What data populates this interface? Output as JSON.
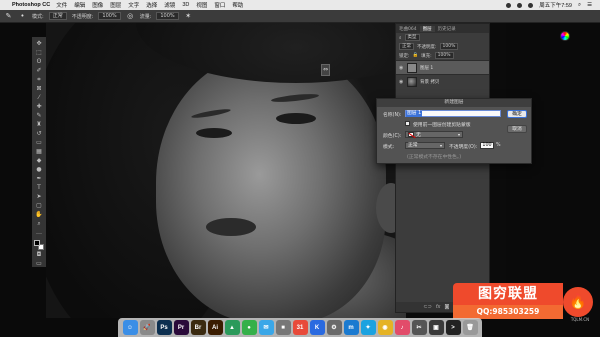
{
  "menubar": {
    "app": "Photoshop CC",
    "items": [
      "文件",
      "编辑",
      "图像",
      "图层",
      "文字",
      "选择",
      "滤镜",
      "3D",
      "视图",
      "窗口",
      "帮助"
    ],
    "clock": "周五下午7:59"
  },
  "optbar": {
    "mode_label": "模式:",
    "mode_value": "正常",
    "opacity_label": "不透明度:",
    "opacity_value": "100%",
    "flow_label": "流量:",
    "flow_value": "100%"
  },
  "layers_panel": {
    "tabs": [
      "毛曲064",
      "图层",
      "历史记录"
    ],
    "filter_label": "类型",
    "blend_value": "正常",
    "opacity_label": "不透明度:",
    "opacity_value": "100%",
    "lock_label": "锁定:",
    "fill_label": "填充:",
    "fill_value": "100%",
    "layers": [
      {
        "name": "图层 1"
      },
      {
        "name": "背景 拷贝"
      }
    ],
    "footer_fx": "fx"
  },
  "dialog": {
    "title": "新建图层",
    "name_label": "名称(N):",
    "name_value": "图层 1",
    "ok_label": "确定",
    "cancel_label": "取消",
    "clip_label": "使用前一图层创建剪贴蒙版",
    "color_label": "颜色(C):",
    "color_value": "无",
    "mode_label": "模式:",
    "mode_value": "正常",
    "opacity_label": "不透明度(O):",
    "opacity_value": "100",
    "opacity_unit": "%",
    "hint": "(正常模式不存在中性色。)"
  },
  "watermark": {
    "title": "图穷联盟",
    "qq": "QQ:985303259",
    "site": "TQLM.CN"
  },
  "dock": {
    "icons": [
      {
        "name": "finder-icon",
        "glyph": "☺",
        "color": "#3a8ee6"
      },
      {
        "name": "launchpad-icon",
        "glyph": "🚀",
        "color": "#8a8a8a"
      },
      {
        "name": "photoshop-icon",
        "glyph": "Ps",
        "color": "#0c2f4f"
      },
      {
        "name": "premiere-icon",
        "glyph": "Pr",
        "color": "#2a0a3a"
      },
      {
        "name": "bridge-icon",
        "glyph": "Br",
        "color": "#3a2a10"
      },
      {
        "name": "illustrator-icon",
        "glyph": "Ai",
        "color": "#3a1c00"
      },
      {
        "name": "drive-icon",
        "glyph": "▲",
        "color": "#2b9a5b"
      },
      {
        "name": "wechat-icon",
        "glyph": "●",
        "color": "#35b04a"
      },
      {
        "name": "messages-icon",
        "glyph": "✉",
        "color": "#3aa7e8"
      },
      {
        "name": "app-icon",
        "glyph": "■",
        "color": "#777"
      },
      {
        "name": "calendar-icon",
        "glyph": "31",
        "color": "#e84a3a"
      },
      {
        "name": "keynote-icon",
        "glyph": "K",
        "color": "#2a6ae0"
      },
      {
        "name": "settings-icon",
        "glyph": "⚙",
        "color": "#6a6a6a"
      },
      {
        "name": "mail-icon",
        "glyph": "m",
        "color": "#1a7ad0"
      },
      {
        "name": "bird-icon",
        "glyph": "✦",
        "color": "#1ba2e0"
      },
      {
        "name": "chrome-icon",
        "glyph": "◉",
        "color": "#e5b325"
      },
      {
        "name": "music-icon",
        "glyph": "♪",
        "color": "#e24c6a"
      },
      {
        "name": "tool-icon",
        "glyph": "✂",
        "color": "#555"
      },
      {
        "name": "display-icon",
        "glyph": "▣",
        "color": "#3a3a3a"
      },
      {
        "name": "terminal-icon",
        "glyph": ">",
        "color": "#222"
      },
      {
        "name": "trash-icon",
        "glyph": "🗑",
        "color": "#999"
      }
    ]
  }
}
